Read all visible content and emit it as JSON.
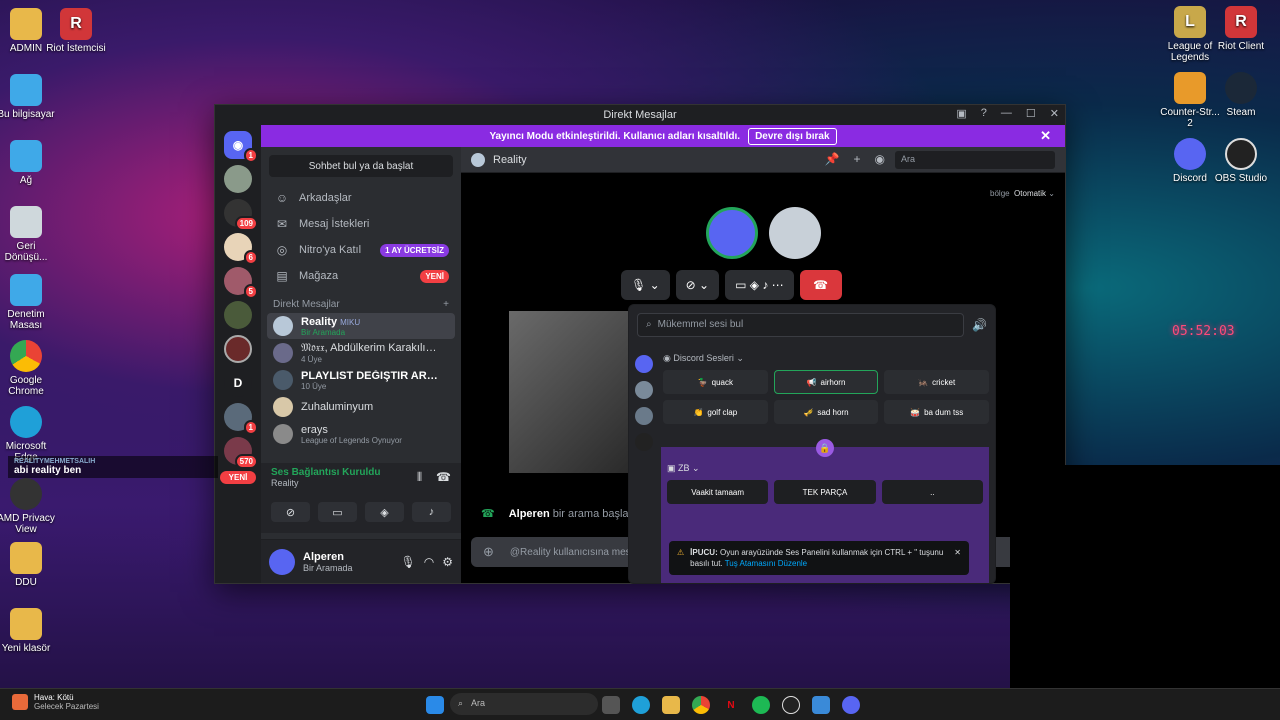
{
  "desktop": {
    "icons": [
      {
        "label": "ADMIN",
        "icon": "folder-icon",
        "color": "#e8b84a"
      },
      {
        "label": "Riot İstemcisi",
        "icon": "riot-icon",
        "color": "#d13639"
      },
      {
        "label": "Bu bilgisayar",
        "icon": "computer-icon",
        "color": "#3fa9e8"
      },
      {
        "label": "Ağ",
        "icon": "network-icon",
        "color": "#3fa9e8"
      },
      {
        "label": "Geri Dönüşü...",
        "icon": "recycle-bin-icon",
        "color": "#cfd8dc"
      },
      {
        "label": "Denetim Masası",
        "icon": "control-panel-icon",
        "color": "#3fa9e8"
      },
      {
        "label": "Google Chrome",
        "icon": "chrome-icon",
        "color": "#34a853"
      },
      {
        "label": "Microsoft Edge",
        "icon": "edge-icon",
        "color": "#1fa0d8"
      },
      {
        "label": "AMD Privacy View",
        "icon": "amd-icon",
        "color": "#333"
      },
      {
        "label": "DDU",
        "icon": "folder-icon",
        "color": "#e8b84a"
      },
      {
        "label": "Yeni klasör",
        "icon": "folder-icon",
        "color": "#e8b84a"
      },
      {
        "label": "League of Legends",
        "icon": "lol-icon",
        "color": "#c8a84a"
      },
      {
        "label": "Riot Client",
        "icon": "riot-icon",
        "color": "#d13639"
      },
      {
        "label": "Counter-Str... 2",
        "icon": "cs2-icon",
        "color": "#e89a2a"
      },
      {
        "label": "Steam",
        "icon": "steam-icon",
        "color": "#1b2838"
      },
      {
        "label": "Discord",
        "icon": "discord-icon",
        "color": "#5865f2"
      },
      {
        "label": "OBS Studio",
        "icon": "obs-icon",
        "color": "#222"
      }
    ],
    "overlay_user": "REALITYMEHMETSALIH",
    "overlay_text": "abi reality ben",
    "clock_overlay": "05:52:03"
  },
  "window": {
    "title": "Direkt Mesajlar",
    "banner_text": "Yayıncı Modu etkinleştirildi. Kullanıcı adları kısaltıldı.",
    "banner_button": "Devre dışı bırak"
  },
  "guilds": [
    {
      "label": "",
      "badge": "1"
    },
    {
      "label": "",
      "badge": ""
    },
    {
      "label": "",
      "badge": "109"
    },
    {
      "label": "",
      "badge": "6"
    },
    {
      "label": "",
      "badge": "5"
    },
    {
      "label": "",
      "badge": ""
    },
    {
      "label": "",
      "badge": ""
    },
    {
      "label": "D",
      "badge": ""
    },
    {
      "label": "",
      "badge": "1"
    },
    {
      "label": "",
      "badge": "570"
    },
    {
      "label": "YENİ",
      "badge": ""
    }
  ],
  "dm": {
    "find_button": "Sohbet bul ya da başlat",
    "nav": [
      {
        "label": "Arkadaşlar",
        "pill": "",
        "icon": "friends-icon"
      },
      {
        "label": "Mesaj İstekleri",
        "pill": "",
        "icon": "mail-icon"
      },
      {
        "label": "Nitro'ya Katıl",
        "pill": "1 AY ÜCRETSİZ",
        "icon": "nitro-icon"
      },
      {
        "label": "Mağaza",
        "pill": "YENİ",
        "icon": "shop-icon"
      }
    ],
    "header": "Direkt Mesajlar",
    "rows": [
      {
        "name": "Reality",
        "tag": "MIKU",
        "sub": "Bir Aramada"
      },
      {
        "name": "𝔐𝔬𝔵𝔵, Abdülkerim Karakılıç, ...",
        "tag": "",
        "sub": "4 Üye"
      },
      {
        "name": "PLAYLIST DEĞIŞTIR ARTIK A...",
        "tag": "",
        "sub": "10 Üye"
      },
      {
        "name": "Zuhaluminyum",
        "tag": "",
        "sub": ""
      },
      {
        "name": "erays",
        "tag": "",
        "sub": "League of Legends Oynuyor"
      }
    ]
  },
  "voice": {
    "status": "Ses Bağlantısı Kuruldu",
    "channel": "Reality"
  },
  "user": {
    "name": "Alperen",
    "status": "Bir Aramada"
  },
  "main": {
    "channel": "Reality",
    "search_placeholder": "Ara",
    "region_label": "bölge",
    "region_value": "Otomatik",
    "call_message_user": "Alperen",
    "call_message_text": "bir arama başlattı",
    "input_placeholder": "@Reality kullanıcısına mes"
  },
  "soundboard": {
    "search_placeholder": "Mükemmel sesi bul",
    "section1": "Discord Sesleri",
    "section1_sounds": [
      "quack",
      "airhorn",
      "cricket",
      "golf clap",
      "sad horn",
      "ba dum tss"
    ],
    "section2": "ZB",
    "section2_sounds": [
      "Vaakit tamaam",
      "TEK PARÇA",
      ".."
    ],
    "tip_title": "İPUCU:",
    "tip_text": "Oyun arayüzünde Ses Panelini kullanmak için CTRL + \" tuşunu basılı tut.",
    "tip_link": "Tuş Atamasını Düzenle"
  },
  "taskbar": {
    "weather_title": "Hava: Kötü",
    "weather_sub": "Gelecek Pazartesi",
    "search_placeholder": "Ara"
  }
}
